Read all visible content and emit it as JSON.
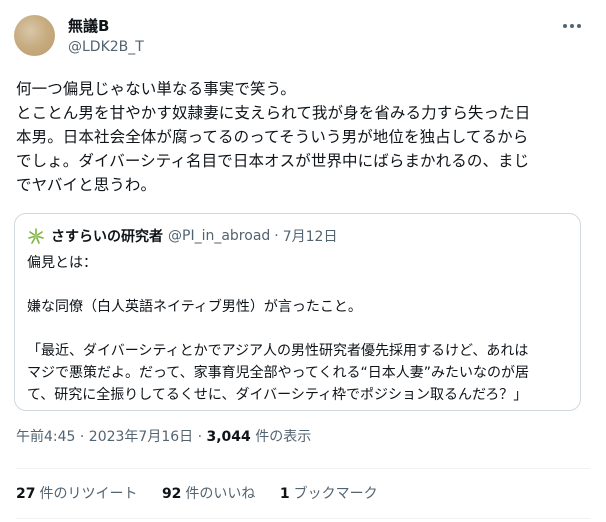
{
  "tweet": {
    "display_name": "無議B",
    "handle": "@LDK2B_T",
    "body_lines": [
      "何一つ偏見じゃない単なる事実で笑う。",
      "とことん男を甘やかす奴隷妻に支えられて我が身を省みる力すら失った日",
      "本男。日本社会全体が腐ってるのってそういう男が地位を独占してるから",
      "でしょ。ダイバーシティ名目で日本オスが世界中にばらまかれるの、まじ",
      "でヤバイと思うわ。"
    ],
    "icons": {
      "more": "more-options-icon",
      "avatar": "user-avatar"
    }
  },
  "quote": {
    "display_name": "さすらいの研究者",
    "handle": "@PI_in_abroad",
    "separator": "·",
    "date": "7月12日",
    "lines": [
      "偏見とは：",
      "",
      "嫌な同僚（白人英語ネイティブ男性）が言ったこと。",
      "",
      "「最近、ダイバーシティとかでアジア人の男性研究者優先採用するけど、あれは",
      "マジで悪策だよ。だって、家事育児全部やってくれる“日本人妻”みたいなのが居",
      "て、研究に全振りしてるくせに、ダイバーシティ枠でポジション取るんだろ？」"
    ],
    "avatar_icon": "leaf-avatar-icon"
  },
  "meta": {
    "time_date": "午前4:45 · 2023年7月16日 · ",
    "views_count": "3,044",
    "views_label": " 件の表示"
  },
  "stats": {
    "retweets_count": "27",
    "retweets_label": "件のリツイート",
    "likes_count": "92",
    "likes_label": "件のいいね",
    "bookmarks_count": "1",
    "bookmarks_label": "ブックマーク"
  },
  "colors": {
    "text": "#0f1419",
    "secondary": "#536471",
    "border": "#cfd9de",
    "avatar": "#c8ad82",
    "leaf": "#7cb342"
  }
}
